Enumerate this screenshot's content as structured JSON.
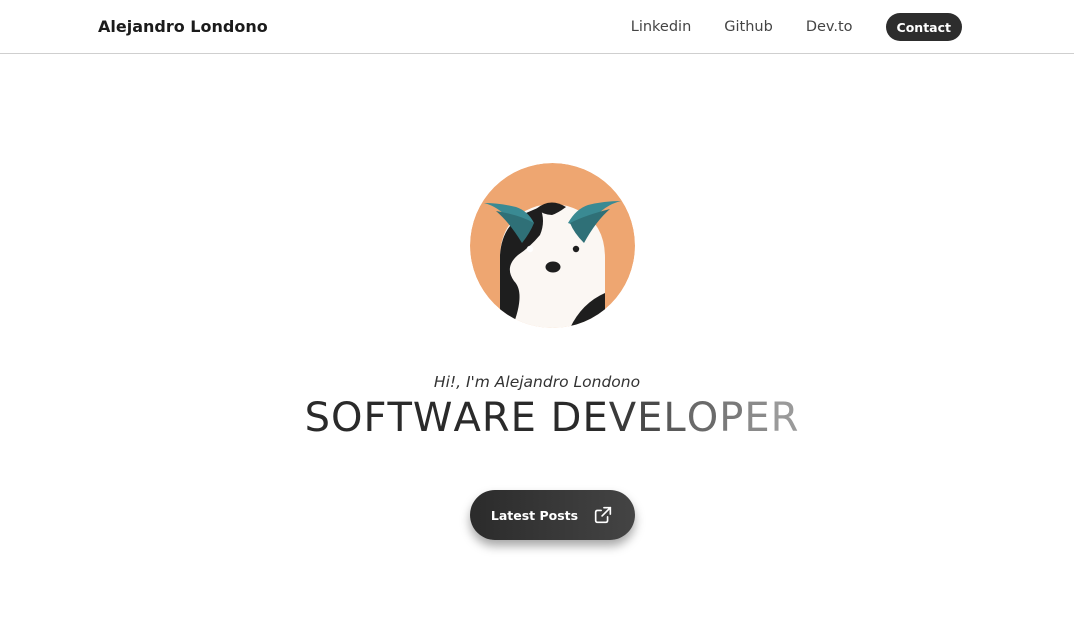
{
  "navbar": {
    "brand": "Alejandro Londono",
    "links": [
      {
        "label": "Linkedin"
      },
      {
        "label": "Github"
      },
      {
        "label": "Dev.to"
      }
    ],
    "contact_label": "Contact"
  },
  "hero": {
    "avatar_icon": "badger-avatar-icon",
    "greeting": "Hi!, I'm Alejandro Londono",
    "headline": "SOFTWARE DEVELOPER",
    "headline_colors": {
      "start": "#2a2a2a",
      "end": "#9a9a9a"
    },
    "cta_label": "Latest Posts",
    "cta_icon": "external-link-icon"
  },
  "colors": {
    "avatar_bg": "#eea671",
    "accent_teal": "#3a8a93",
    "button_dark": "#2d2d2d"
  }
}
